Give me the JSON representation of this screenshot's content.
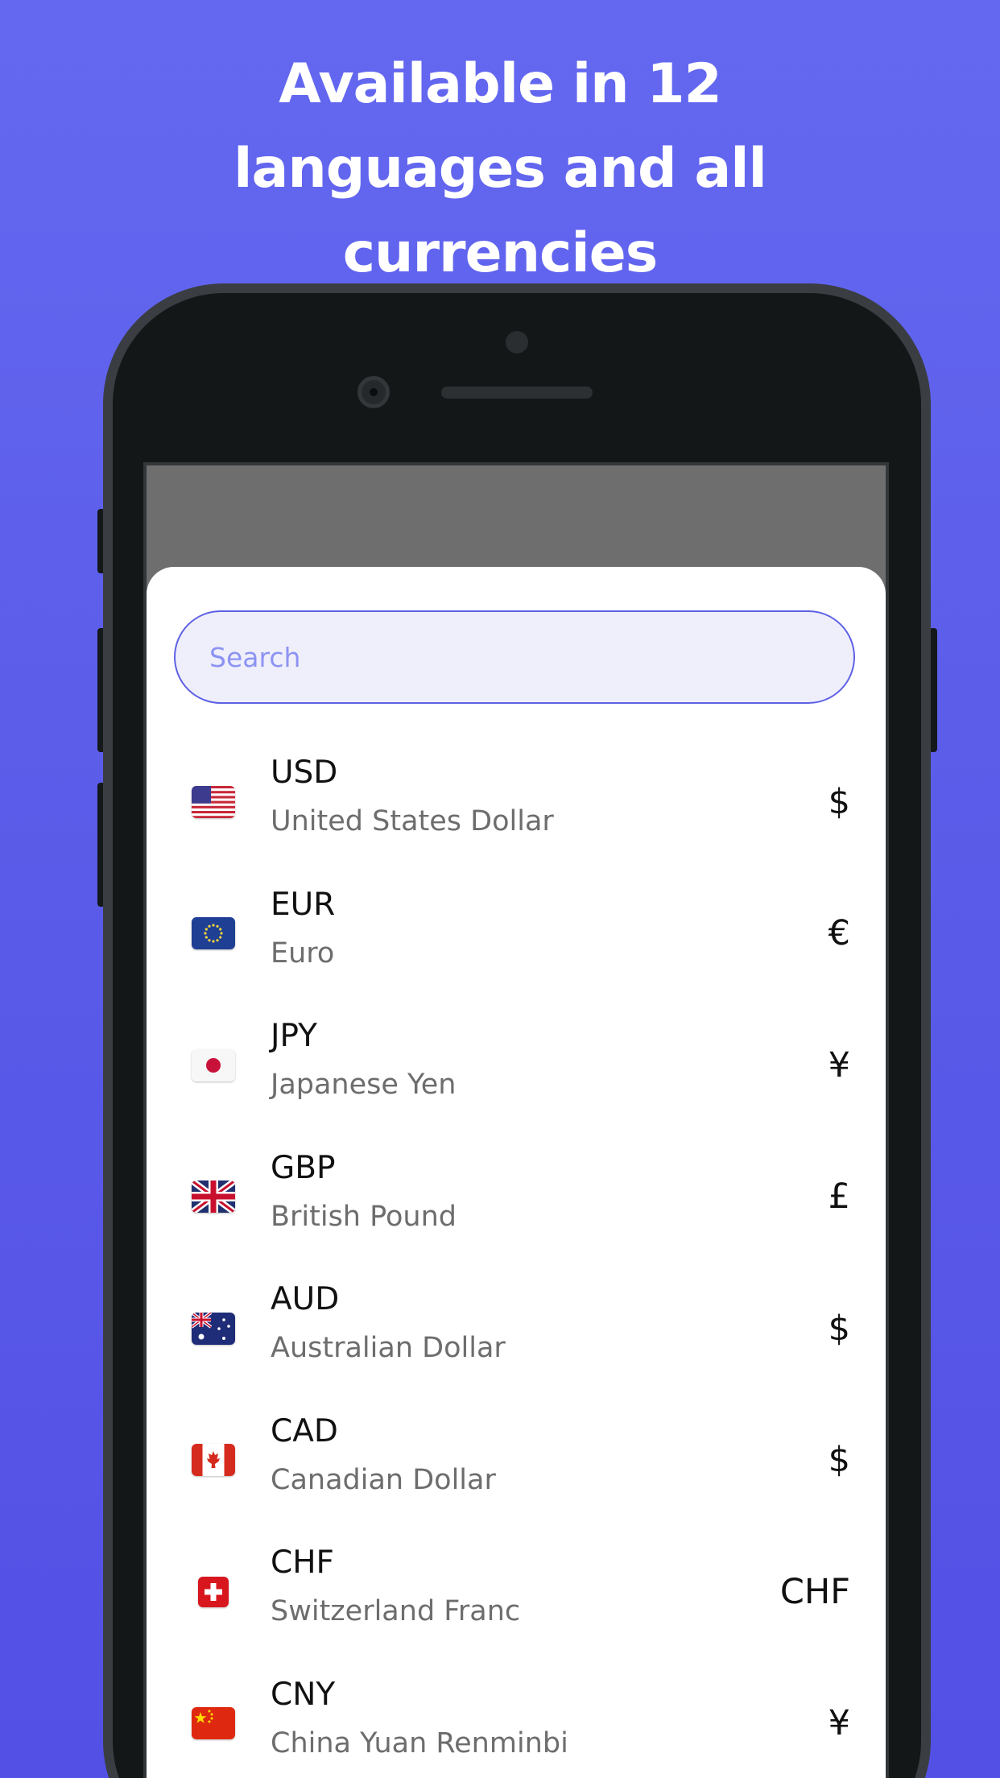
{
  "headline": {
    "line1": "Available in 12",
    "line2": "languages and all",
    "line3": "currencies"
  },
  "colors": {
    "background": "#5d5eeb",
    "accent": "#5d61e4",
    "search_fill": "#efeffb",
    "placeholder": "#8d93f2"
  },
  "search": {
    "placeholder": "Search"
  },
  "currencies": [
    {
      "code": "USD",
      "name": "United States Dollar",
      "symbol": "$",
      "flag": "us-flag-icon"
    },
    {
      "code": "EUR",
      "name": "Euro",
      "symbol": "€",
      "flag": "eu-flag-icon"
    },
    {
      "code": "JPY",
      "name": "Japanese Yen",
      "symbol": "¥",
      "flag": "jp-flag-icon"
    },
    {
      "code": "GBP",
      "name": "British Pound",
      "symbol": "£",
      "flag": "gb-flag-icon"
    },
    {
      "code": "AUD",
      "name": "Australian Dollar",
      "symbol": "$",
      "flag": "au-flag-icon"
    },
    {
      "code": "CAD",
      "name": "Canadian Dollar",
      "symbol": "$",
      "flag": "ca-flag-icon"
    },
    {
      "code": "CHF",
      "name": "Switzerland Franc",
      "symbol": "CHF",
      "flag": "ch-flag-icon"
    },
    {
      "code": "CNY",
      "name": "China Yuan Renminbi",
      "symbol": "¥",
      "flag": "cn-flag-icon"
    }
  ]
}
